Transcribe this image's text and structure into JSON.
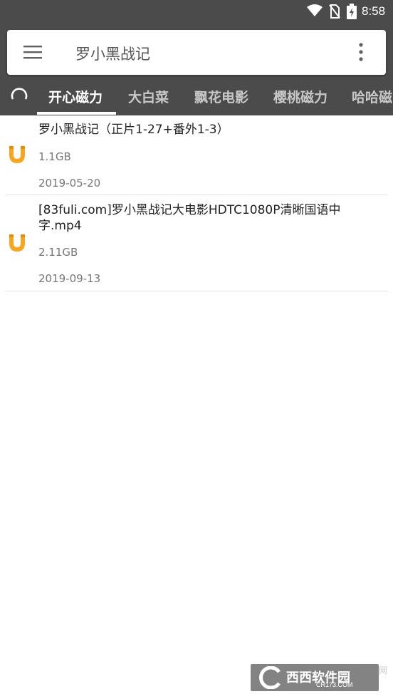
{
  "status_bar": {
    "time": "8:58",
    "icons": [
      "wifi-icon",
      "no-sim-icon",
      "battery-charging-icon"
    ]
  },
  "search_bar": {
    "query": "罗小黑战记",
    "menu_icon": "hamburger-menu-icon",
    "more_icon": "more-vert-icon"
  },
  "tabs": [
    {
      "label": "开心磁力",
      "active": true
    },
    {
      "label": "大白菜",
      "active": false
    },
    {
      "label": "飘花电影",
      "active": false
    },
    {
      "label": "樱桃磁力",
      "active": false
    },
    {
      "label": "哈哈磁",
      "active": false
    }
  ],
  "results": [
    {
      "title": "罗小黑战记（正片1-27+番外1-3）",
      "size": "1.1GB",
      "date": "2019-05-20",
      "icon": "magnet-icon"
    },
    {
      "title": "[83fuli.com]罗小黑战记大电影HDTC1080P清晰国语中字.mp4",
      "size": "2.11GB",
      "date": "2019-09-13",
      "icon": "magnet-icon"
    }
  ],
  "watermark": {
    "brand": "西西软件园",
    "domain": "CR173.COM",
    "side": "网"
  },
  "colors": {
    "header": "#4b4b4b",
    "magnet": "#f5a623",
    "accent_text": "#ffffff"
  }
}
